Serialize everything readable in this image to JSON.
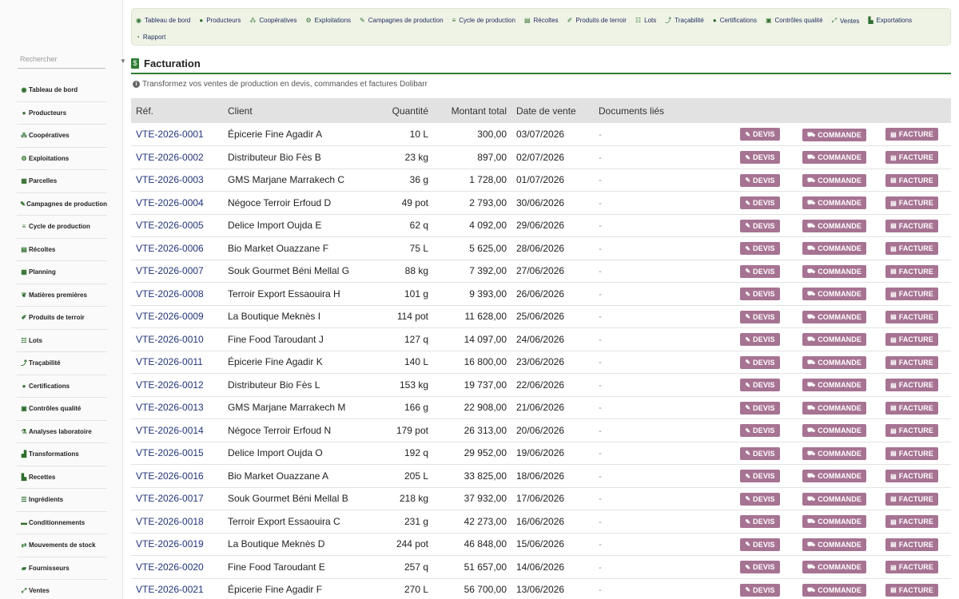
{
  "search": {
    "placeholder": "Rechercher"
  },
  "sidebar": [
    {
      "icon": "dashboard-icon",
      "glyph": "◉",
      "label": "Tableau de bord"
    },
    {
      "icon": "user-icon",
      "glyph": "●",
      "label": "Producteurs"
    },
    {
      "icon": "users-icon",
      "glyph": "⁂",
      "label": "Coopératives"
    },
    {
      "icon": "tractor-icon",
      "glyph": "⚙",
      "label": "Exploitations"
    },
    {
      "icon": "parcel-icon",
      "glyph": "▦",
      "label": "Parcelles"
    },
    {
      "icon": "seedling-icon",
      "glyph": "✎",
      "label": "Campagnes de production"
    },
    {
      "icon": "list-icon",
      "glyph": "≡",
      "label": "Cycle de production"
    },
    {
      "icon": "harvest-icon",
      "glyph": "▤",
      "label": "Récoltes"
    },
    {
      "icon": "calendar-icon",
      "glyph": "▦",
      "label": "Planning"
    },
    {
      "icon": "leaf-icon",
      "glyph": "❦",
      "label": "Matières premières"
    },
    {
      "icon": "sprout-icon",
      "glyph": "✐",
      "label": "Produits de terroir"
    },
    {
      "icon": "lots-icon",
      "glyph": "☷",
      "label": "Lots"
    },
    {
      "icon": "trace-icon",
      "glyph": "⤴",
      "label": "Traçabilité"
    },
    {
      "icon": "certificate-icon",
      "glyph": "●",
      "label": "Certifications"
    },
    {
      "icon": "clipboard-icon",
      "glyph": "▣",
      "label": "Contrôles qualité"
    },
    {
      "icon": "lab-icon",
      "glyph": "⚗",
      "label": "Analyses laboratoire"
    },
    {
      "icon": "industry-icon",
      "glyph": "▟",
      "label": "Transformations"
    },
    {
      "icon": "recipe-icon",
      "glyph": "▙",
      "label": "Recettes"
    },
    {
      "icon": "ingredients-icon",
      "glyph": "☰",
      "label": "Ingrédients"
    },
    {
      "icon": "box-icon",
      "glyph": "▬",
      "label": "Conditionnements"
    },
    {
      "icon": "exchange-icon",
      "glyph": "⇄",
      "label": "Mouvements de stock"
    },
    {
      "icon": "truck-icon",
      "glyph": "▰",
      "label": "Fournisseurs"
    },
    {
      "icon": "sales-icon",
      "glyph": "⤢",
      "label": "Ventes"
    }
  ],
  "topmenu": [
    {
      "icon": "dashboard-icon",
      "glyph": "◉",
      "label": "Tableau de bord"
    },
    {
      "icon": "user-icon",
      "glyph": "●",
      "label": "Producteurs"
    },
    {
      "icon": "users-icon",
      "glyph": "⁂",
      "label": "Coopératives"
    },
    {
      "icon": "tractor-icon",
      "glyph": "⚙",
      "label": "Exploitations"
    },
    {
      "icon": "seedling-icon",
      "glyph": "✎",
      "label": "Campagnes de production"
    },
    {
      "icon": "list-icon",
      "glyph": "≡",
      "label": "Cycle de production"
    },
    {
      "icon": "harvest-icon",
      "glyph": "▤",
      "label": "Récoltes"
    },
    {
      "icon": "sprout-icon",
      "glyph": "✐",
      "label": "Produits de terroir"
    },
    {
      "icon": "lots-icon",
      "glyph": "☷",
      "label": "Lots"
    },
    {
      "icon": "trace-icon",
      "glyph": "⤴",
      "label": "Traçabilité"
    },
    {
      "icon": "certificate-icon",
      "glyph": "●",
      "label": "Certifications"
    },
    {
      "icon": "clipboard-icon",
      "glyph": "▣",
      "label": "Contrôles qualité"
    },
    {
      "icon": "sales-icon",
      "glyph": "⤢",
      "label": "Ventes"
    },
    {
      "icon": "export-icon",
      "glyph": "▙",
      "label": "Exportations"
    },
    {
      "icon": "report-icon",
      "glyph": "◔",
      "label": "Rapport"
    }
  ],
  "page": {
    "title": "Facturation",
    "info": "Transformez vos ventes de production en devis, commandes et factures Dolibarr"
  },
  "table": {
    "headers": [
      "Réf.",
      "Client",
      "Quantité",
      "Montant total",
      "Date de vente",
      "Documents liés"
    ],
    "actions": {
      "devis": "DEVIS",
      "commande": "COMMANDE",
      "facture": "FACTURE"
    },
    "rows": [
      {
        "ref": "VTE-2026-0001",
        "client": "Épicerie Fine Agadir A",
        "qty": "10 L",
        "amount": "300,00",
        "date": "03/07/2026",
        "docs": "-"
      },
      {
        "ref": "VTE-2026-0002",
        "client": "Distributeur Bio Fès B",
        "qty": "23 kg",
        "amount": "897,00",
        "date": "02/07/2026",
        "docs": "-"
      },
      {
        "ref": "VTE-2026-0003",
        "client": "GMS Marjane Marrakech C",
        "qty": "36 g",
        "amount": "1 728,00",
        "date": "01/07/2026",
        "docs": "-"
      },
      {
        "ref": "VTE-2026-0004",
        "client": "Négoce Terroir Erfoud D",
        "qty": "49 pot",
        "amount": "2 793,00",
        "date": "30/06/2026",
        "docs": "-"
      },
      {
        "ref": "VTE-2026-0005",
        "client": "Delice Import Oujda E",
        "qty": "62 q",
        "amount": "4 092,00",
        "date": "29/06/2026",
        "docs": "-"
      },
      {
        "ref": "VTE-2026-0006",
        "client": "Bio Market Ouazzane F",
        "qty": "75 L",
        "amount": "5 625,00",
        "date": "28/06/2026",
        "docs": "-"
      },
      {
        "ref": "VTE-2026-0007",
        "client": "Souk Gourmet Béni Mellal G",
        "qty": "88 kg",
        "amount": "7 392,00",
        "date": "27/06/2026",
        "docs": "-"
      },
      {
        "ref": "VTE-2026-0008",
        "client": "Terroir Export Essaouira H",
        "qty": "101 g",
        "amount": "9 393,00",
        "date": "26/06/2026",
        "docs": "-"
      },
      {
        "ref": "VTE-2026-0009",
        "client": "La Boutique Meknès I",
        "qty": "114 pot",
        "amount": "11 628,00",
        "date": "25/06/2026",
        "docs": "-"
      },
      {
        "ref": "VTE-2026-0010",
        "client": "Fine Food Taroudant J",
        "qty": "127 q",
        "amount": "14 097,00",
        "date": "24/06/2026",
        "docs": "-"
      },
      {
        "ref": "VTE-2026-0011",
        "client": "Épicerie Fine Agadir K",
        "qty": "140 L",
        "amount": "16 800,00",
        "date": "23/06/2026",
        "docs": "-"
      },
      {
        "ref": "VTE-2026-0012",
        "client": "Distributeur Bio Fès L",
        "qty": "153 kg",
        "amount": "19 737,00",
        "date": "22/06/2026",
        "docs": "-"
      },
      {
        "ref": "VTE-2026-0013",
        "client": "GMS Marjane Marrakech M",
        "qty": "166 g",
        "amount": "22 908,00",
        "date": "21/06/2026",
        "docs": "-"
      },
      {
        "ref": "VTE-2026-0014",
        "client": "Négoce Terroir Erfoud N",
        "qty": "179 pot",
        "amount": "26 313,00",
        "date": "20/06/2026",
        "docs": "-"
      },
      {
        "ref": "VTE-2026-0015",
        "client": "Delice Import Oujda O",
        "qty": "192 q",
        "amount": "29 952,00",
        "date": "19/06/2026",
        "docs": "-"
      },
      {
        "ref": "VTE-2026-0016",
        "client": "Bio Market Ouazzane A",
        "qty": "205 L",
        "amount": "33 825,00",
        "date": "18/06/2026",
        "docs": "-"
      },
      {
        "ref": "VTE-2026-0017",
        "client": "Souk Gourmet Béni Mellal B",
        "qty": "218 kg",
        "amount": "37 932,00",
        "date": "17/06/2026",
        "docs": "-"
      },
      {
        "ref": "VTE-2026-0018",
        "client": "Terroir Export Essaouira C",
        "qty": "231 g",
        "amount": "42 273,00",
        "date": "16/06/2026",
        "docs": "-"
      },
      {
        "ref": "VTE-2026-0019",
        "client": "La Boutique Meknès D",
        "qty": "244 pot",
        "amount": "46 848,00",
        "date": "15/06/2026",
        "docs": "-"
      },
      {
        "ref": "VTE-2026-0020",
        "client": "Fine Food Taroudant E",
        "qty": "257 q",
        "amount": "51 657,00",
        "date": "14/06/2026",
        "docs": "-"
      },
      {
        "ref": "VTE-2026-0021",
        "client": "Épicerie Fine Agadir F",
        "qty": "270 L",
        "amount": "56 700,00",
        "date": "13/06/2026",
        "docs": "-"
      }
    ]
  },
  "colors": {
    "accent": "#2e7d32",
    "button": "#a77393",
    "link": "#23357a",
    "menu_bg": "#eff3e6"
  }
}
